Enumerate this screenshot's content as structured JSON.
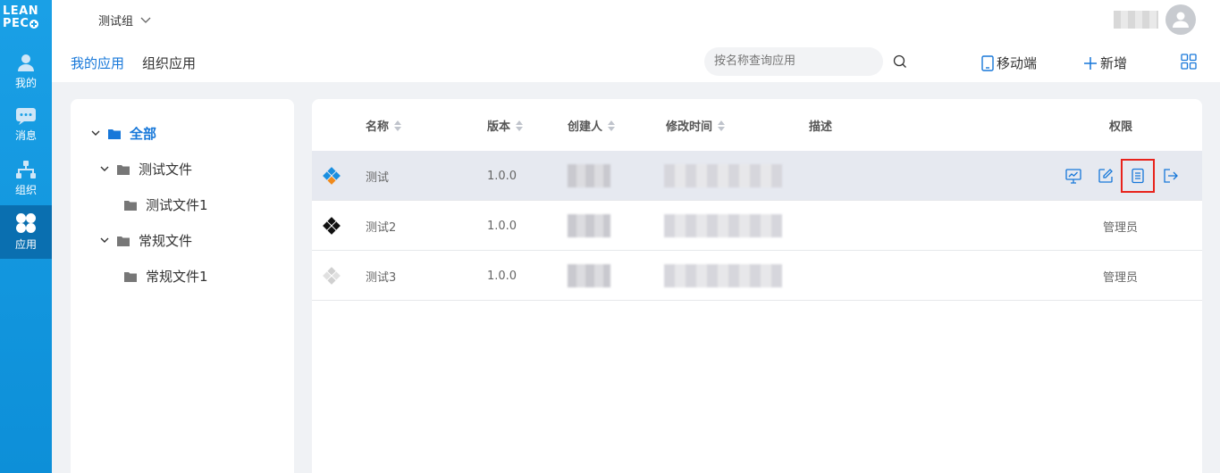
{
  "brand": {
    "logo_line1": "LEAN",
    "logo_line2": "PEC"
  },
  "rail": [
    {
      "label": "我的",
      "icon": "user-icon"
    },
    {
      "label": "消息",
      "icon": "message-icon"
    },
    {
      "label": "组织",
      "icon": "org-icon"
    },
    {
      "label": "应用",
      "icon": "apps-icon",
      "active": true
    }
  ],
  "header": {
    "group": "测试组",
    "tabs": {
      "mine": "我的应用",
      "org": "组织应用"
    },
    "search_placeholder": "按名称查询应用",
    "mobile_label": "移动端",
    "add_label": "新增"
  },
  "tree": {
    "root": "全部",
    "folders": [
      {
        "label": "测试文件",
        "children": [
          "测试文件1"
        ]
      },
      {
        "label": "常规文件",
        "children": [
          "常规文件1"
        ]
      }
    ]
  },
  "table": {
    "columns": {
      "name": "名称",
      "version": "版本",
      "creator": "创建人",
      "modified": "修改时间",
      "desc": "描述",
      "perm": "权限"
    },
    "rows": [
      {
        "name": "测试",
        "version": "1.0.0",
        "perm": "",
        "icon_color": "#1a8fe0",
        "selected": true
      },
      {
        "name": "测试2",
        "version": "1.0.0",
        "perm": "管理员",
        "icon_color": "#111111"
      },
      {
        "name": "测试3",
        "version": "1.0.0",
        "perm": "管理员",
        "icon_color": "#d0d0d0"
      }
    ],
    "actions": [
      "monitor-icon",
      "edit-icon",
      "document-icon",
      "exit-icon"
    ]
  },
  "colors": {
    "accent": "#1677d9",
    "rail": "#1aa0e6",
    "highlight": "#e8231c"
  }
}
